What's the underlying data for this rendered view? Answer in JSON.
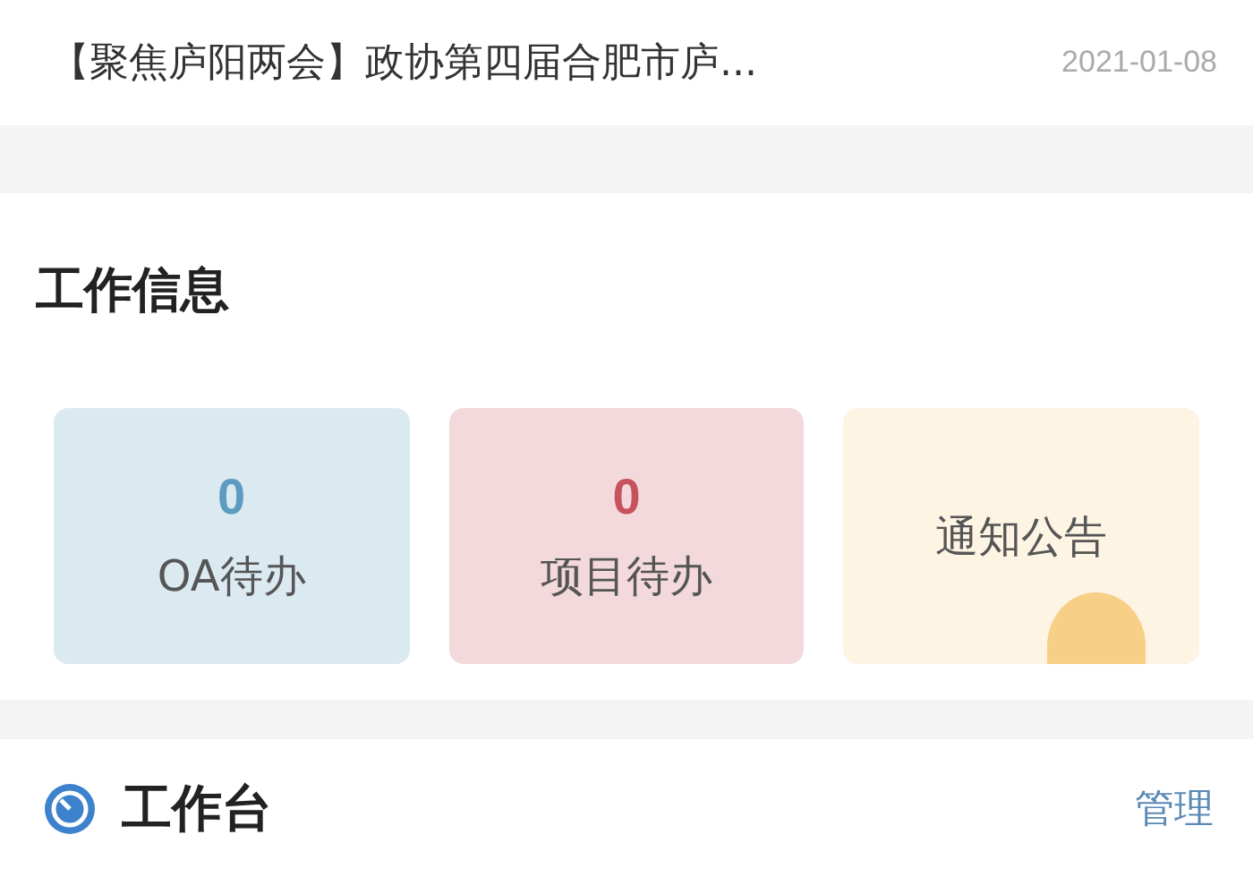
{
  "news": {
    "title": "【聚焦庐阳两会】政协第四届合肥市庐...",
    "date": "2021-01-08"
  },
  "work_info": {
    "title": "工作信息",
    "cards": [
      {
        "kind": "count",
        "count": "0",
        "label": "OA待办",
        "color": "#5b9cc0"
      },
      {
        "kind": "count",
        "count": "0",
        "label": "项目待办",
        "color": "#c8525c"
      },
      {
        "kind": "plain",
        "label": "通知公告",
        "color": "#f8cf86"
      }
    ]
  },
  "workbench": {
    "title": "工作台",
    "action": "管理"
  }
}
